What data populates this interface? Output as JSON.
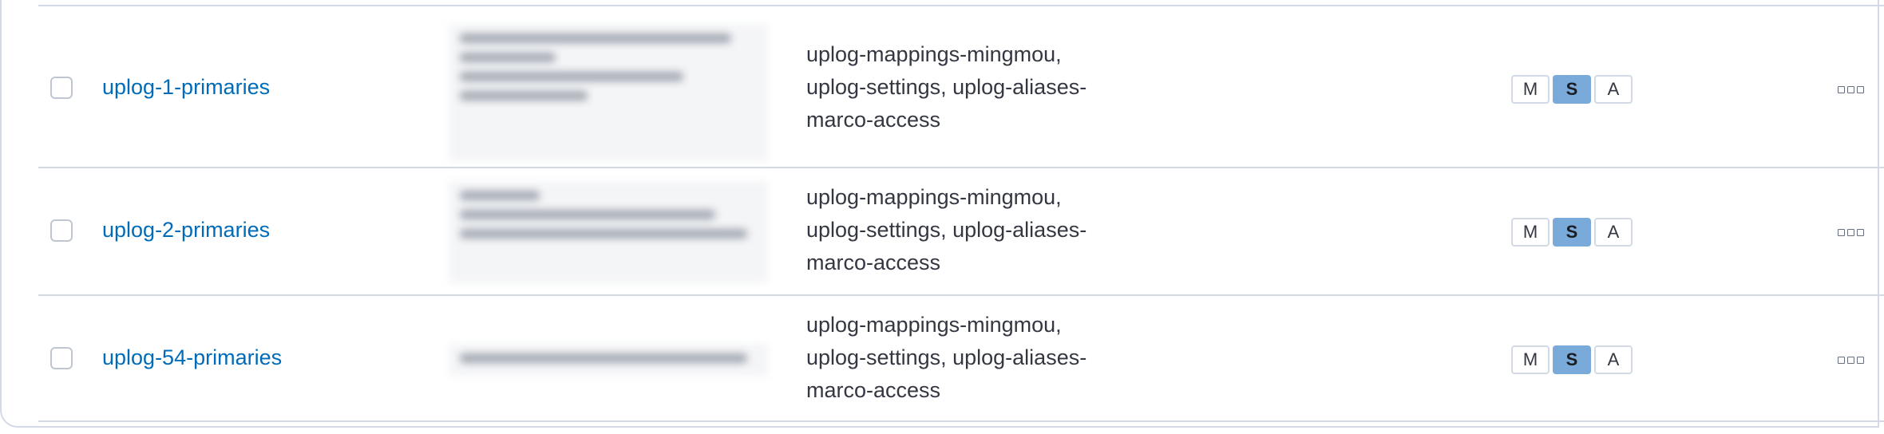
{
  "rows": [
    {
      "name": "uplog-1-primaries",
      "templates": [
        "uplog-mappings-mingmou,",
        "uplog-settings, uplog-aliases-",
        "marco-access"
      ],
      "badges": {
        "m": "M",
        "s": "S",
        "a": "A"
      }
    },
    {
      "name": "uplog-2-primaries",
      "templates": [
        "uplog-mappings-mingmou,",
        "uplog-settings, uplog-aliases-",
        "marco-access"
      ],
      "badges": {
        "m": "M",
        "s": "S",
        "a": "A"
      }
    },
    {
      "name": "uplog-54-primaries",
      "templates": [
        "uplog-mappings-mingmou,",
        "uplog-settings, uplog-aliases-",
        "marco-access"
      ],
      "badges": {
        "m": "M",
        "s": "S",
        "a": "A"
      }
    }
  ],
  "colors": {
    "link": "#006bb8",
    "active_badge": "#79aad9",
    "border": "#d3dae6"
  },
  "icons": {
    "row_actions": "more-horizontal-icon"
  }
}
